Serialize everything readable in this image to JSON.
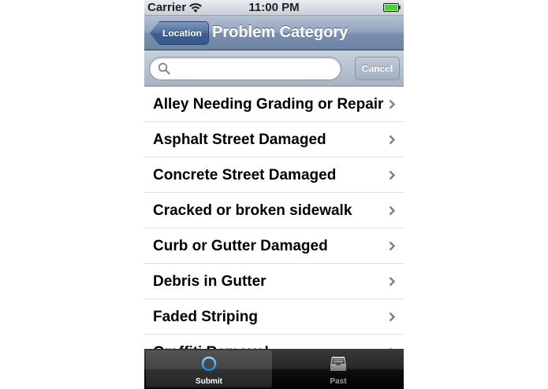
{
  "status_bar": {
    "carrier": "Carrier",
    "time": "11:00 PM"
  },
  "nav_bar": {
    "back_label": "Location",
    "title": "Problem Category"
  },
  "search": {
    "placeholder": "",
    "value": "",
    "cancel_label": "Cancel"
  },
  "list": {
    "items": [
      {
        "label": "Alley Needing Grading or Repair"
      },
      {
        "label": "Asphalt Street Damaged"
      },
      {
        "label": "Concrete Street Damaged"
      },
      {
        "label": "Cracked or broken sidewalk"
      },
      {
        "label": "Curb or Gutter Damaged"
      },
      {
        "label": "Debris in Gutter"
      },
      {
        "label": "Faded Striping"
      },
      {
        "label": "Graffiti Removal"
      }
    ]
  },
  "tab_bar": {
    "tabs": [
      {
        "label": "Submit",
        "icon": "crosshair-icon",
        "selected": true
      },
      {
        "label": "Past",
        "icon": "inbox-tray-icon",
        "selected": false
      }
    ]
  },
  "colors": {
    "nav_bar": "#8fa2bd",
    "tab_bar": "#1a1a1a",
    "battery": "#4cd137"
  }
}
